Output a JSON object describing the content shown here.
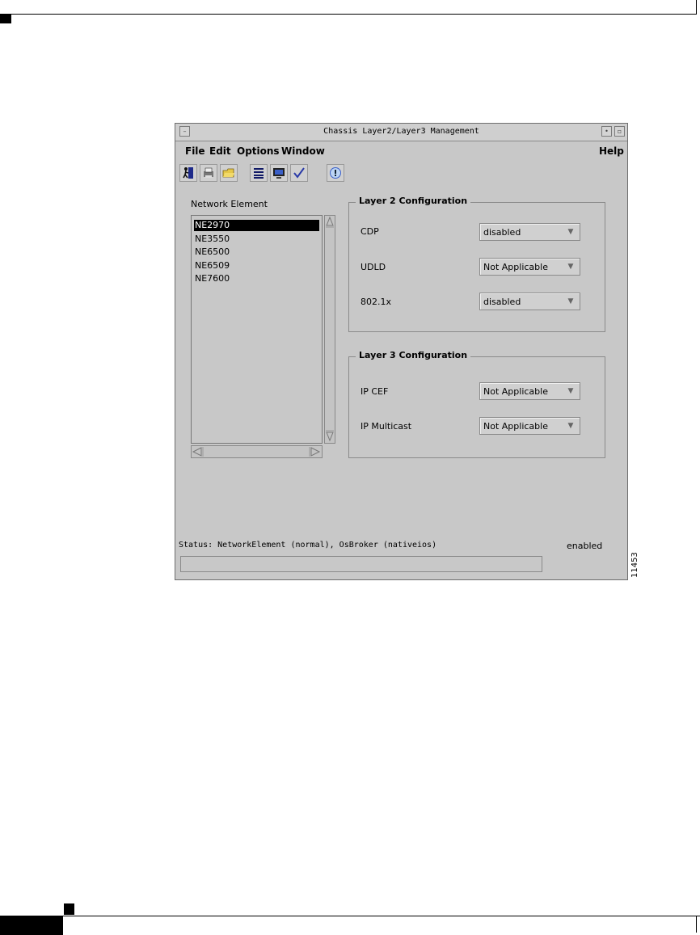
{
  "window": {
    "title": "Chassis Layer2/Layer3 Management",
    "minimize_glyph": "–",
    "restore_glyph": "▫"
  },
  "menu": {
    "file": "File",
    "edit": "Edit",
    "options": "Options",
    "window": "Window",
    "help": "Help"
  },
  "toolbar": {
    "icons": [
      "exit-icon",
      "print-icon",
      "open-folder-icon",
      "list-icon",
      "monitor-icon",
      "check-icon",
      "info-icon"
    ]
  },
  "network_element": {
    "label": "Network Element",
    "items": [
      "NE2970",
      "NE3550",
      "NE6500",
      "NE6509",
      "NE7600"
    ],
    "selected": "NE2970"
  },
  "layer2": {
    "title": "Layer 2 Configuration",
    "cdp_label": "CDP",
    "cdp_value": "disabled",
    "udld_label": "UDLD",
    "udld_value": "Not Applicable",
    "dot1x_label": "802.1x",
    "dot1x_value": "disabled"
  },
  "layer3": {
    "title": "Layer 3 Configuration",
    "ipcef_label": "IP CEF",
    "ipcef_value": "Not Applicable",
    "ipmulticast_label": "IP Multicast",
    "ipmulticast_value": "Not Applicable"
  },
  "status": {
    "text": "Status: NetworkElement (normal), OsBroker (nativeios)",
    "state": "enabled"
  },
  "figure_id": "11453"
}
